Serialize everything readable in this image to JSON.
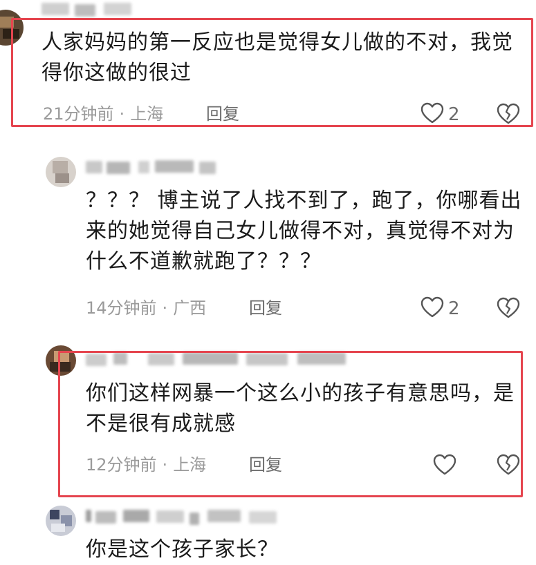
{
  "comments": [
    {
      "text": "人家妈妈的第一反应也是觉得女儿做的不对，我觉得你这做的很过",
      "time": "21分钟前",
      "location": "上海",
      "reply_label": "回复",
      "like_count": "2",
      "highlighted": true
    },
    {
      "text": "？？？ 博主说了人找不到了，跑了，你哪看出来的她觉得自己女儿做得不对，真觉得不对为什么不道歉就跑了？？？",
      "time": "14分钟前",
      "location": "广西",
      "reply_label": "回复",
      "like_count": "2",
      "highlighted": false
    },
    {
      "text": "你们这样网暴一个这么小的孩子有意思吗，是不是很有成就感",
      "time": "12分钟前",
      "location": "上海",
      "reply_label": "回复",
      "like_count": "",
      "highlighted": true
    },
    {
      "text": "你是这个孩子家长？",
      "time": "",
      "location": "",
      "reply_label": "",
      "like_count": "",
      "highlighted": false
    }
  ],
  "meta_separator": "·",
  "colors": {
    "highlight_border": "#e5454f",
    "meta_text": "#9a9a9a",
    "icon_stroke": "#555555"
  },
  "icons": {
    "like": "heart-outline-icon",
    "dislike": "broken-heart-icon"
  }
}
